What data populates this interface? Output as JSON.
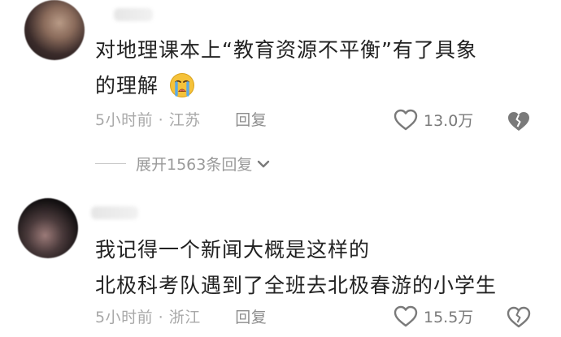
{
  "comments": [
    {
      "text_line1": "对地理课本上“教育资源不平衡”有了具象",
      "text_line2": "的理解",
      "emoji": "loudly-crying-face",
      "time_location": "5小时前 · 江苏",
      "reply_label": "回复",
      "likes": "13.0万"
    },
    {
      "text_line1": "我记得一个新闻大概是这样的",
      "text_line2": "北极科考队遇到了全班去北极春游的小学生",
      "time_location": "5小时前 · 浙江",
      "reply_label": "回复",
      "likes": "15.5万"
    }
  ],
  "expand_replies": "展开1563条回复",
  "colors": {
    "text": "#222222",
    "meta": "#a8a8a8",
    "icon": "#7a7a7a",
    "emoji_face": "#f5c23a",
    "emoji_tears": "#5aa9e6"
  }
}
